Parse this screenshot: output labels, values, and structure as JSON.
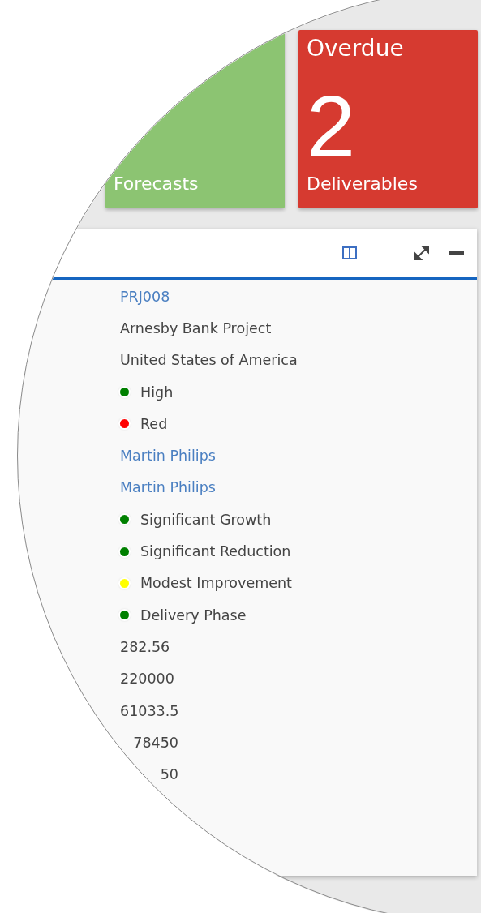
{
  "tiles": [
    {
      "label": "Forecasts",
      "color": "#8cc472"
    },
    {
      "title": "Overdue",
      "count": "2",
      "label": "Deliverables",
      "color": "#d63a30"
    }
  ],
  "panel": {
    "rows": [
      {
        "kind": "link",
        "text": "PRJ008"
      },
      {
        "kind": "text",
        "text": "Arnesby Bank Project"
      },
      {
        "kind": "text",
        "text": "United States of America"
      },
      {
        "kind": "status",
        "text": "High",
        "color": "#008000"
      },
      {
        "kind": "status",
        "text": "Red",
        "color": "#ff0000"
      },
      {
        "kind": "link",
        "text": "Martin Philips"
      },
      {
        "kind": "link",
        "text": "Martin Philips"
      },
      {
        "kind": "status",
        "text": "Significant Growth",
        "color": "#008000"
      },
      {
        "kind": "status",
        "text": "Significant Reduction",
        "color": "#008000"
      },
      {
        "kind": "status",
        "text": "Modest Improvement",
        "color": "#ffff00"
      },
      {
        "kind": "status",
        "text": "Delivery Phase",
        "color": "#008000"
      },
      {
        "kind": "text",
        "text": "282.56"
      },
      {
        "kind": "text",
        "text": "220000"
      },
      {
        "kind": "text",
        "text": "61033.5"
      },
      {
        "kind": "cut",
        "text": "78450"
      },
      {
        "kind": "cut",
        "text": "50"
      }
    ]
  }
}
